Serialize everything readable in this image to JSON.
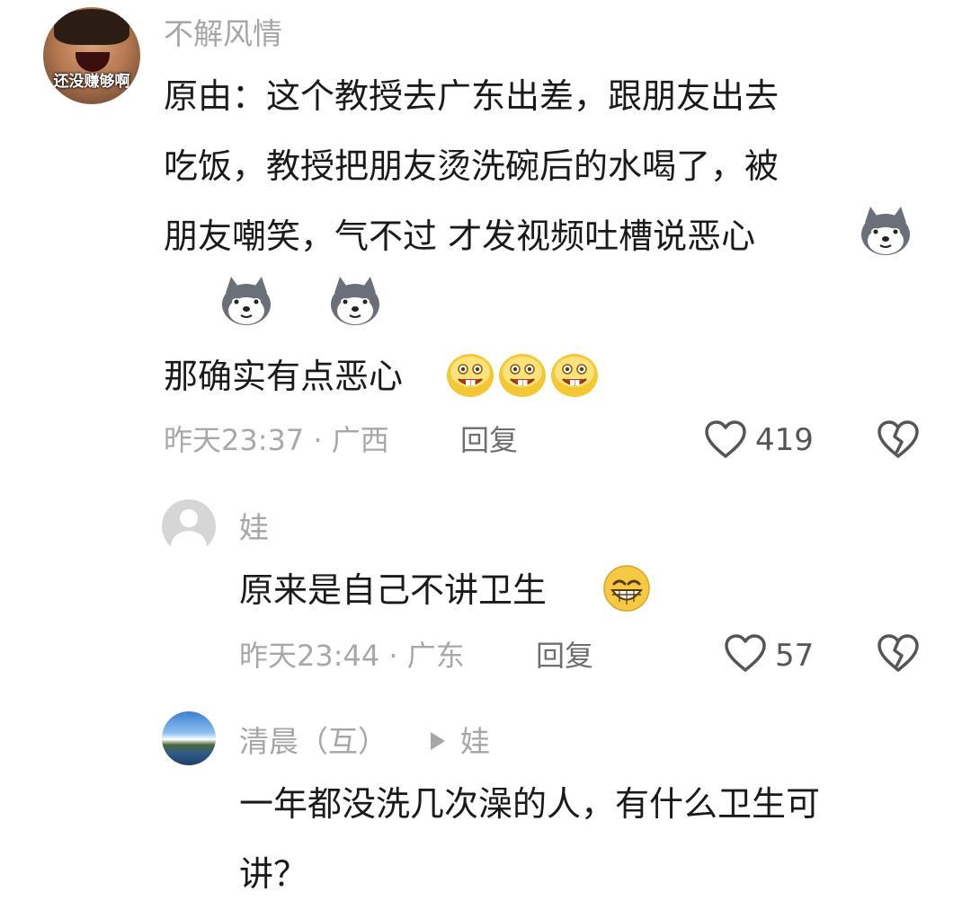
{
  "comment1": {
    "author": "不解风情",
    "avatar_caption": "还没赚够啊",
    "line1": "原由：这个教授去广东出差，跟朋友出去",
    "line2": "吃饭，教授把朋友烫洗碗后的水喝了，被",
    "line3": "朋友嘲笑，气不过 才发视频吐槽说恶心",
    "line5": "那确实有点恶心",
    "time_location": "昨天23:37 · 广西",
    "reply_label": "回复",
    "likes": "419"
  },
  "comment2": {
    "author": "娃",
    "text": "原来是自己不讲卫生",
    "time_location": "昨天23:44 · 广东",
    "reply_label": "回复",
    "likes": "57"
  },
  "comment3": {
    "author": "清晨（互）",
    "reply_to": "娃",
    "line1": "一年都没洗几次澡的人，有什么卫生可",
    "line2": "讲？"
  },
  "icons": {
    "like": "heart-outline-icon",
    "dislike": "broken-heart-icon",
    "reply_arrow": "play-triangle-icon",
    "husky": "husky-emoji",
    "smile": "grin-emoji"
  },
  "colors": {
    "name": "#a6a6a6",
    "text": "#1a1a1a",
    "meta": "#a8a8a8"
  }
}
